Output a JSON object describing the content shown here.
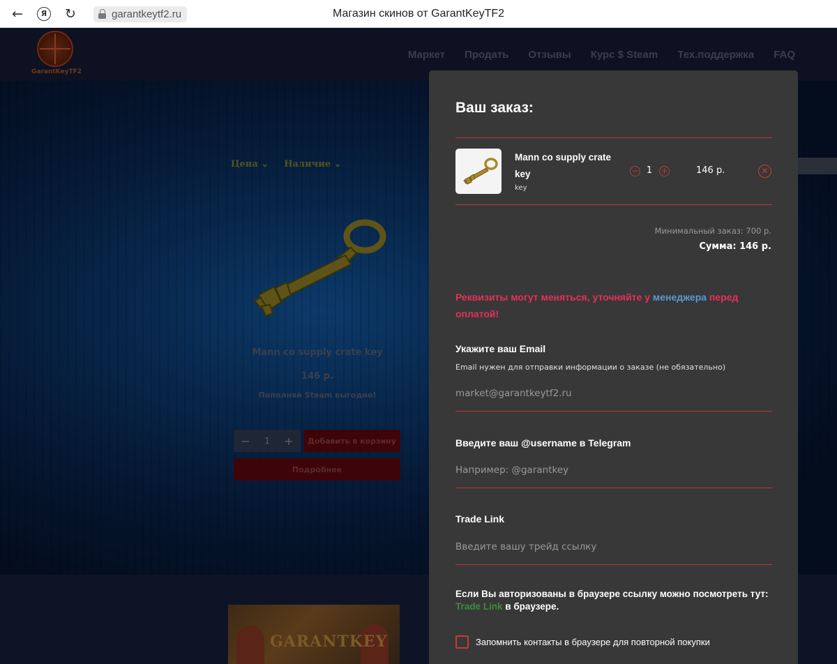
{
  "browser": {
    "url": "garantkeytf2.ru",
    "tab_title": "Магазин скинов от GarantKeyTF2",
    "yandex_label": "Я"
  },
  "site": {
    "logo_text": "GarantKeyTF2",
    "nav": [
      "Маркет",
      "Продать",
      "Отзывы",
      "Курс $ Steam",
      "Тех.поддержка",
      "FAQ"
    ],
    "filters": [
      "Цена",
      "Наличие"
    ],
    "product": {
      "name": "Mann co supply crate key",
      "price": "146 р.",
      "promo": "Пополняй Steam выгодно!",
      "qty": "1",
      "add_to_cart": "Добавить в корзину",
      "details": "Подробнее"
    },
    "banner_text": "GARANTKEY"
  },
  "order": {
    "title": "Ваш заказ:",
    "item": {
      "name": "Mann co supply crate key",
      "subtitle": "key",
      "qty": "1",
      "price": "146 р."
    },
    "min_order": "Минимальный заказ: 700 р.",
    "total": "Сумма: 146 р.",
    "warning_before": "Реквизиты могут меняться, уточняйте у ",
    "warning_link": "менеджера",
    "warning_after": " перед оплатой!",
    "email": {
      "label": "Укажите ваш Email",
      "hint": "Email нужен для отправки информации о заказе (не обязательно)",
      "placeholder": "market@garantkeytf2.ru"
    },
    "telegram": {
      "label": "Введите ваш @username в Telegram",
      "placeholder": "Например: @garantkey"
    },
    "trade": {
      "label": "Trade Link",
      "placeholder": "Введите вашу трейд ссылку"
    },
    "auth_note_before": "Если Вы авторизованы в браузере ссылку можно посмотреть тут: ",
    "auth_note_link": "Trade Link",
    "auth_note_after": " в браузере.",
    "remember_label": "Запомнить контакты в браузере для повторной покупки"
  }
}
